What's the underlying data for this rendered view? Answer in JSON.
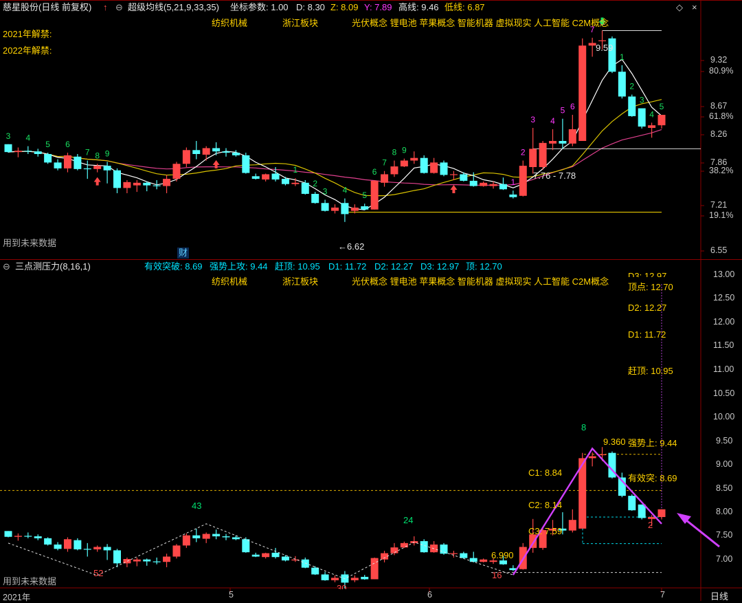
{
  "colors": {
    "up": "#ff4848",
    "down": "#54ffff",
    "ma1": "#ffffff",
    "ma2": "#d9c200",
    "ma3": "#e0408e",
    "ma_ref": "#ff2cff",
    "level_yellow": "#e8c800",
    "level_dash_yellow": "#e0b000",
    "level_dash_white": "#d0d0d0",
    "level_dash_cyan": "#00d8e8",
    "zigzag": "#d040ff",
    "arrow": "#d040ff",
    "separator": "#8a0000"
  },
  "header": {
    "stock": "慈星股份(日线 前复权)",
    "up_arrow_icon": "red-up-arrow",
    "indicator": "超级均线(5,21,9,33,35)",
    "coord_params": "坐标参数: 1.00",
    "d": "D: 8.30",
    "z": "Z: 8.09",
    "y": "Y: 7.89",
    "high_line": "高线: 9.46",
    "low_line": "低线: 6.87",
    "diamond": "◇",
    "close": "×"
  },
  "upper": {
    "labels": {
      "unlock_2021": "2021年解禁:",
      "unlock_2022": "2022年解禁:",
      "future_data": "用到未来数据",
      "fin_badge": "财",
      "high_tag": "9.59",
      "low_tag": "←6.62",
      "band_tag": "7.76 - 7.78"
    },
    "concepts": [
      "纺织机械",
      "浙江板块",
      "光伏概念 锂电池 苹果概念 智能机器 虚拟现实 人工智能 C2M概念"
    ],
    "y_axis": [
      "9.32",
      "80.9%",
      "8.67",
      "61.8%",
      "8.26",
      "7.86",
      "38.2%",
      "7.21",
      "19.1%",
      "6.55"
    ],
    "seq_counts": [
      {
        "t": "3",
        "c": "gr"
      },
      {
        "t": "4",
        "c": "gr"
      },
      {
        "t": "5",
        "c": "gr"
      },
      {
        "t": "6",
        "c": "gr"
      },
      {
        "t": "7",
        "c": "gr"
      },
      {
        "t": "8",
        "c": "gr"
      },
      {
        "t": "9",
        "c": "gr"
      },
      {
        "t": "1",
        "c": "gr"
      },
      {
        "t": "2",
        "c": "gr"
      },
      {
        "t": "3",
        "c": "gr"
      },
      {
        "t": "4",
        "c": "gr"
      },
      {
        "t": "5",
        "c": "gr"
      },
      {
        "t": "6",
        "c": "gr"
      },
      {
        "t": "7",
        "c": "gr"
      },
      {
        "t": "8",
        "c": "gr"
      },
      {
        "t": "9",
        "c": "gr"
      },
      {
        "t": "1",
        "c": "mg"
      },
      {
        "t": "2",
        "c": "mg"
      },
      {
        "t": "3",
        "c": "mg"
      },
      {
        "t": "4",
        "c": "mg"
      },
      {
        "t": "5",
        "c": "mg"
      },
      {
        "t": "6",
        "c": "mg"
      },
      {
        "t": "7",
        "c": "mg"
      },
      {
        "t": "8",
        "c": "mg"
      },
      {
        "t": "1",
        "c": "gr"
      },
      {
        "t": "2",
        "c": "gr"
      },
      {
        "t": "3",
        "c": "gr"
      },
      {
        "t": "4",
        "c": "gr"
      },
      {
        "t": "5",
        "c": "gr"
      }
    ]
  },
  "lower": {
    "title": "三点测压力(8,16,1)",
    "stats": {
      "valid_break": "有效突破: 8.69",
      "strong_attack": "强势上攻: 9.44",
      "top_chase": "赶顶: 10.95",
      "d1": "D1: 11.72",
      "d2": "D2: 12.27",
      "d3": "D3: 12.97",
      "top": "顶: 12.70"
    },
    "concepts": [
      "纺织机械",
      "浙江板块",
      "光伏概念 锂电池 苹果概念 智能机器 虚拟现实 人工智能 C2M概念"
    ],
    "right_labels": {
      "d3": "D3: 12.97",
      "top_point": "顶点: 12.70",
      "d2": "D2: 12.27",
      "d1": "D1: 11.72",
      "top_chase": "赶顶: 10.95",
      "strong_attack": "强势上: 9.44",
      "valid_break": "有效突: 8.69"
    },
    "inner_labels": {
      "peak": "9.360",
      "c1": "C1: 8.84",
      "c2": "C2: 8.14",
      "c3": "C3: 7.59",
      "low": "6.990"
    },
    "zigzag_counts": [
      "43",
      "52",
      "30",
      "24",
      "16",
      "8",
      "2"
    ],
    "future_data": "用到未来数据",
    "y_axis": [
      "13.00",
      "12.50",
      "12.00",
      "11.50",
      "11.00",
      "10.50",
      "10.00",
      "9.50",
      "9.00",
      "8.50",
      "8.00",
      "7.50",
      "7.00"
    ],
    "x_axis": [
      "2021年",
      "5",
      "6",
      "7"
    ],
    "period_button": "日线"
  },
  "chart_data": [
    {
      "type": "candlestick",
      "title": "慈星股份(日线 前复权)",
      "series": [
        {
          "name": "OHLC",
          "values": [
            [
              7.85,
              7.85,
              7.72,
              7.73
            ],
            [
              7.73,
              7.8,
              7.65,
              7.75
            ],
            [
              7.75,
              7.82,
              7.7,
              7.74
            ],
            [
              7.74,
              7.78,
              7.66,
              7.7
            ],
            [
              7.7,
              7.72,
              7.55,
              7.57
            ],
            [
              7.57,
              7.62,
              7.45,
              7.48
            ],
            [
              7.48,
              7.72,
              7.42,
              7.68
            ],
            [
              7.66,
              7.7,
              7.45,
              7.47
            ],
            [
              7.48,
              7.6,
              7.32,
              7.47
            ],
            [
              7.47,
              7.55,
              7.42,
              7.52
            ],
            [
              7.52,
              7.58,
              7.25,
              7.45
            ],
            [
              7.45,
              7.48,
              7.1,
              7.18
            ],
            [
              7.18,
              7.3,
              7.1,
              7.27
            ],
            [
              7.22,
              7.3,
              7.12,
              7.26
            ],
            [
              7.26,
              7.28,
              7.13,
              7.22
            ],
            [
              7.22,
              7.3,
              7.16,
              7.21
            ],
            [
              7.21,
              7.38,
              7.1,
              7.32
            ],
            [
              7.32,
              7.58,
              7.28,
              7.55
            ],
            [
              7.55,
              7.8,
              7.5,
              7.76
            ],
            [
              7.76,
              7.9,
              7.62,
              7.7
            ],
            [
              7.69,
              7.82,
              7.6,
              7.79
            ],
            [
              7.79,
              7.88,
              7.68,
              7.74
            ],
            [
              7.74,
              7.79,
              7.66,
              7.72
            ],
            [
              7.72,
              7.76,
              7.66,
              7.68
            ],
            [
              7.68,
              7.72,
              7.4,
              7.41
            ],
            [
              7.36,
              7.4,
              7.31,
              7.32
            ],
            [
              7.31,
              7.4,
              7.28,
              7.39
            ],
            [
              7.4,
              7.5,
              7.28,
              7.31
            ],
            [
              7.32,
              7.35,
              7.22,
              7.24
            ],
            [
              7.24,
              7.33,
              7.21,
              7.26
            ],
            [
              7.26,
              7.3,
              7.08,
              7.09
            ],
            [
              7.09,
              7.12,
              6.94,
              6.95
            ],
            [
              6.95,
              7.0,
              6.82,
              6.83
            ],
            [
              6.83,
              6.93,
              6.79,
              6.88
            ],
            [
              6.95,
              7.02,
              6.66,
              6.78
            ],
            [
              6.83,
              6.93,
              6.79,
              6.88
            ],
            [
              6.9,
              6.94,
              6.84,
              6.85
            ],
            [
              6.85,
              7.3,
              6.85,
              7.29
            ],
            [
              7.26,
              7.44,
              7.2,
              7.39
            ],
            [
              7.39,
              7.6,
              7.35,
              7.51
            ],
            [
              7.51,
              7.63,
              7.5,
              7.6
            ],
            [
              7.6,
              7.74,
              7.55,
              7.64
            ],
            [
              7.64,
              7.68,
              7.4,
              7.41
            ],
            [
              7.41,
              7.64,
              7.4,
              7.57
            ],
            [
              7.57,
              7.6,
              7.36,
              7.38
            ],
            [
              7.38,
              7.44,
              7.3,
              7.39
            ],
            [
              7.39,
              7.42,
              7.28,
              7.29
            ],
            [
              7.29,
              7.42,
              7.2,
              7.21
            ],
            [
              7.21,
              7.28,
              7.2,
              7.26
            ],
            [
              7.21,
              7.28,
              7.17,
              7.24
            ],
            [
              7.24,
              7.34,
              7.15,
              7.16
            ],
            [
              7.08,
              7.14,
              7.02,
              7.04
            ],
            [
              7.06,
              7.6,
              7.05,
              7.52
            ],
            [
              7.5,
              8.1,
              7.4,
              7.78
            ],
            [
              7.5,
              7.9,
              7.46,
              7.87
            ],
            [
              7.86,
              8.08,
              7.76,
              7.9
            ],
            [
              7.9,
              8.24,
              7.78,
              7.86
            ],
            [
              7.86,
              8.3,
              7.82,
              8.08
            ],
            [
              7.9,
              9.47,
              7.9,
              9.36
            ],
            [
              9.36,
              9.48,
              9.19,
              9.4
            ],
            [
              9.44,
              9.59,
              9.3,
              9.44
            ],
            [
              9.47,
              9.5,
              8.94,
              8.96
            ],
            [
              8.96,
              9.06,
              8.55,
              8.58
            ],
            [
              8.58,
              8.61,
              8.27,
              8.28
            ],
            [
              8.4,
              8.4,
              8.09,
              8.12
            ],
            [
              8.1,
              8.18,
              7.95,
              8.14
            ],
            [
              8.14,
              8.3,
              8.09,
              8.3
            ]
          ]
        }
      ],
      "levels": {
        "high": 9.59,
        "low": 6.62,
        "band": [
          7.76,
          7.78
        ]
      },
      "ylim": [
        6.5,
        9.7
      ]
    },
    {
      "type": "candlestick",
      "title": "三点测压力(8,16,1)",
      "levels": {
        "valid_break": 8.69,
        "strong_attack": 9.44,
        "top_chase": 10.95,
        "d1": 11.72,
        "d2": 12.27,
        "d3": 12.97,
        "top": 12.7,
        "c1": 8.84,
        "c2": 8.14,
        "c3": 7.59,
        "peak": 9.36,
        "low": 6.99
      },
      "ylim": [
        6.7,
        13.2
      ]
    }
  ]
}
